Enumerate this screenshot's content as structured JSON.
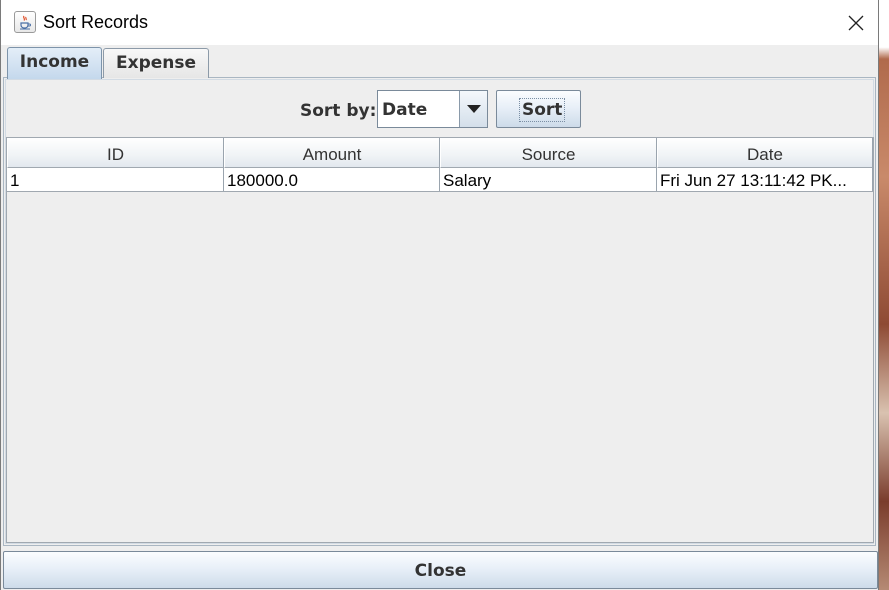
{
  "window": {
    "title": "Sort Records",
    "app_icon": "java-cup-icon",
    "close_icon": "close-icon"
  },
  "tabs": [
    {
      "label": "Income",
      "selected": true
    },
    {
      "label": "Expense",
      "selected": false
    }
  ],
  "toolbar": {
    "sort_label": "Sort by:",
    "sort_field_value": "Date",
    "sort_button_label": "Sort"
  },
  "table": {
    "columns": [
      "ID",
      "Amount",
      "Source",
      "Date"
    ],
    "rows": [
      [
        "1",
        "180000.0",
        "Salary",
        "Fri Jun 27 13:11:42 PK..."
      ]
    ]
  },
  "footer": {
    "close_label": "Close"
  },
  "colors": {
    "tab_selected": "#c4d8ec",
    "button_gradient_bottom": "#cddbe9",
    "panel_bg": "#eeeeee"
  }
}
